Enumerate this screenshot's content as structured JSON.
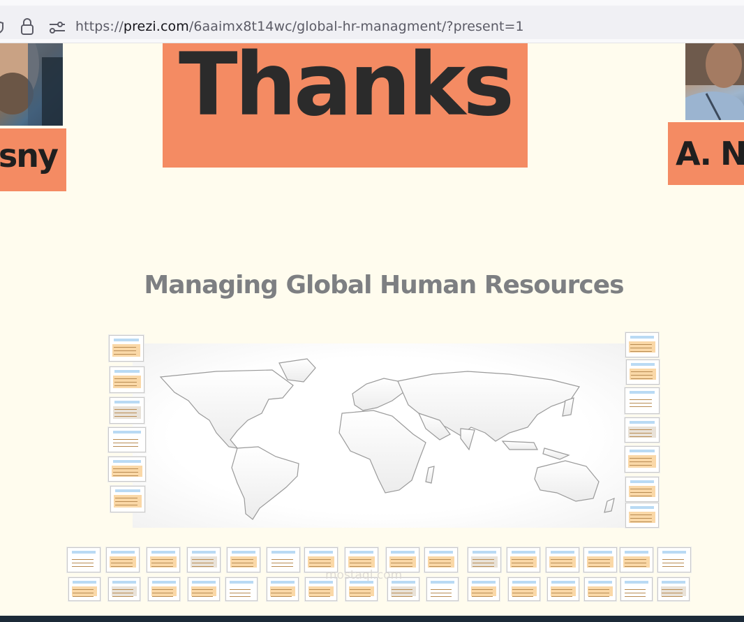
{
  "browser": {
    "url_prefix": "https://",
    "url_host": "prezi.com",
    "url_path": "/6aaimx8t14wc/global-hr-managment/?present=1"
  },
  "slide": {
    "heading": "Thanks",
    "left_name": "osny",
    "right_name": "A. Na",
    "title": "Managing Global Human Resources",
    "watermark": "mostaql.com"
  },
  "colors": {
    "accent": "#f48b63",
    "canvas": "#fffcee",
    "title": "#7d7f82",
    "thumb_header": "#b9daf4",
    "thumb_body": "#fad8a7"
  },
  "thumbnail_count": 45
}
